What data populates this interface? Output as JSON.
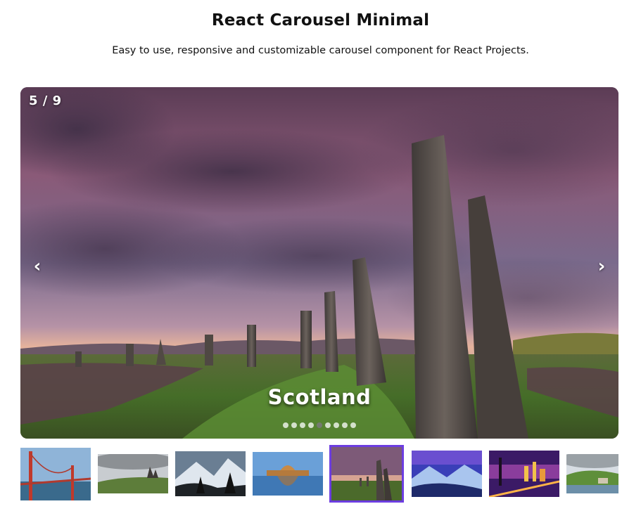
{
  "header": {
    "title": "React Carousel Minimal",
    "subtitle": "Easy to use, responsive and customizable carousel component for React Projects."
  },
  "carousel": {
    "counter": "5 / 9",
    "caption": "Scotland",
    "prev_icon": "‹",
    "next_icon": "›",
    "current_index": 5,
    "total": 9,
    "dots": [
      1,
      2,
      3,
      4,
      5,
      6,
      7,
      8,
      9
    ]
  },
  "thumbnails": [
    {
      "name": "thumbnail-golden-gate-bridge",
      "subject": "golden-gate-bridge"
    },
    {
      "name": "thumbnail-rock-hills",
      "subject": "rock-hills"
    },
    {
      "name": "thumbnail-mountain-trees",
      "subject": "mountain-trees"
    },
    {
      "name": "thumbnail-palace-reflection",
      "subject": "palace-reflection"
    },
    {
      "name": "thumbnail-scotland-stones",
      "subject": "scotland-stones"
    },
    {
      "name": "thumbnail-blue-mountains",
      "subject": "blue-mountains"
    },
    {
      "name": "thumbnail-city-bridge-night",
      "subject": "city-bridge-night"
    },
    {
      "name": "thumbnail-green-valley",
      "subject": "green-valley"
    }
  ],
  "colors": {
    "accent": "#6c3de0",
    "sky_top": "#6d4a68",
    "sky_mid": "#8a6f8f",
    "horizon": "#e8b49c",
    "grass": "#4a7a2c",
    "stone": "#5a534e"
  }
}
